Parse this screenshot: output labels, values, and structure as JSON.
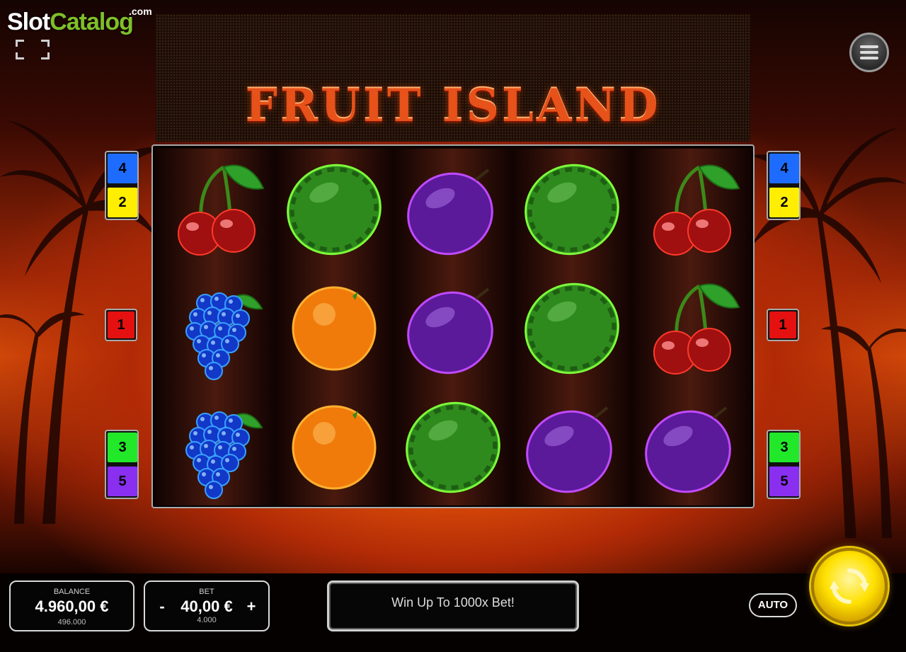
{
  "watermark": {
    "slot": "Slot",
    "catalog": "Catalog",
    "com": ".com"
  },
  "game": {
    "title": "FRUIT ISLAND"
  },
  "reels": [
    [
      "cherry",
      "grapes",
      "grapes"
    ],
    [
      "watermelon",
      "orange",
      "orange"
    ],
    [
      "plum",
      "plum",
      "watermelon"
    ],
    [
      "watermelon",
      "watermelon",
      "plum"
    ],
    [
      "cherry",
      "cherry",
      "plum"
    ]
  ],
  "paylines": {
    "left": [
      "4",
      "2",
      "1",
      "3",
      "5"
    ],
    "right": [
      "4",
      "2",
      "1",
      "3",
      "5"
    ]
  },
  "balance": {
    "label": "BALANCE",
    "value": "4.960,00 €",
    "sub": "496.000"
  },
  "bet": {
    "label": "BET",
    "minus": "-",
    "value": "40,00 €",
    "plus": "+",
    "sub": "4.000"
  },
  "message": "Win Up To 1000x Bet!",
  "auto_label": "AUTO",
  "colors": {
    "payline_4": "#1e6cff",
    "payline_2": "#ffee00",
    "payline_1": "#e51010",
    "payline_3": "#22e82a",
    "payline_5": "#8a2ef0",
    "spin": "#ffe100"
  },
  "icons": {
    "menu": "hamburger-icon",
    "fullscreen": "fullscreen-icon",
    "spin": "refresh-icon"
  }
}
